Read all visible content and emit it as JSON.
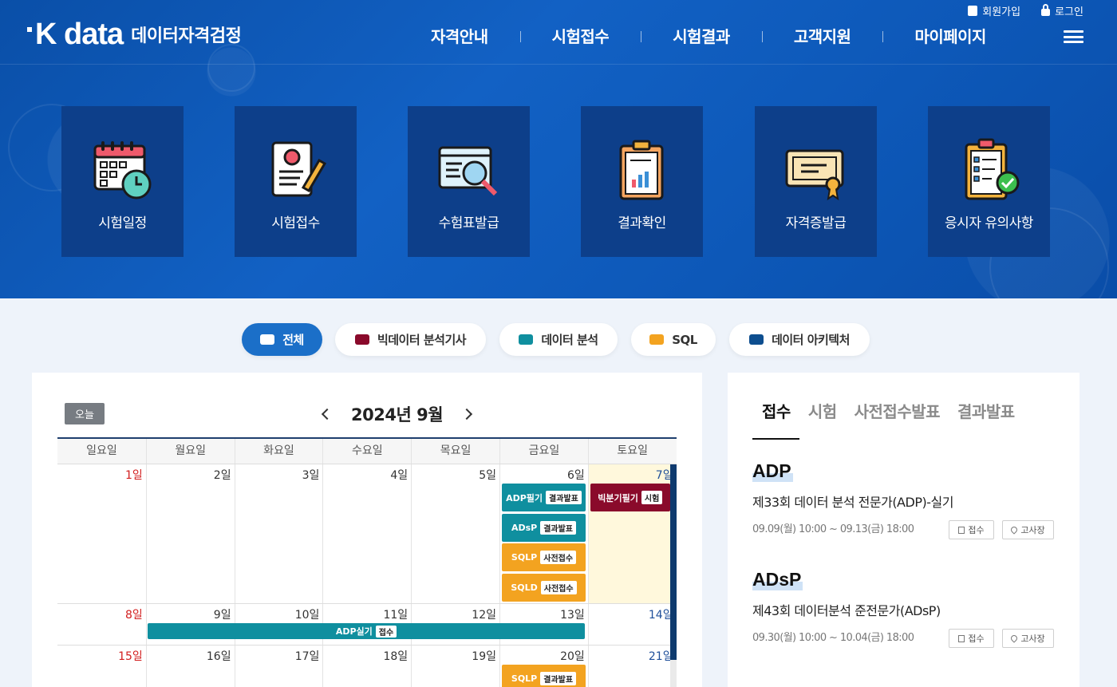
{
  "header": {
    "logo_mark": "K data",
    "logo_text": "데이터자격검정",
    "util": {
      "signup": "회원가입",
      "login": "로그인"
    },
    "nav": [
      "자격안내",
      "시험접수",
      "시험결과",
      "고객지원",
      "마이페이지"
    ]
  },
  "quick_menu": [
    {
      "label": "시험일정",
      "icon": "calendar-clock-icon"
    },
    {
      "label": "시험접수",
      "icon": "application-form-icon"
    },
    {
      "label": "수험표발급",
      "icon": "search-window-icon"
    },
    {
      "label": "결과확인",
      "icon": "clipboard-chart-icon"
    },
    {
      "label": "자격증발급",
      "icon": "certificate-icon"
    },
    {
      "label": "응시자 유의사항",
      "icon": "checklist-icon"
    }
  ],
  "filters": [
    {
      "label": "전체",
      "color": "#ffffff",
      "active": true
    },
    {
      "label": "빅데이터 분석기사",
      "color": "#8a0a2b"
    },
    {
      "label": "데이터 분석",
      "color": "#0f8f9f"
    },
    {
      "label": "SQL",
      "color": "#f3a320"
    },
    {
      "label": "데이터 아키텍처",
      "color": "#0d4e8f"
    }
  ],
  "calendar": {
    "today_label": "오늘",
    "month_title": "2024년 9월",
    "weekdays": [
      "일요일",
      "월요일",
      "화요일",
      "수요일",
      "목요일",
      "금요일",
      "토요일"
    ],
    "weeks": [
      [
        "1일",
        "2일",
        "3일",
        "4일",
        "5일",
        "6일",
        "7일"
      ],
      [
        "8일",
        "9일",
        "10일",
        "11일",
        "12일",
        "13일",
        "14일"
      ],
      [
        "15일",
        "16일",
        "17일",
        "18일",
        "19일",
        "20일",
        "21일"
      ]
    ],
    "events": {
      "adp_written": {
        "name": "ADP필기",
        "tag": "결과발표"
      },
      "adsp": {
        "name": "ADsP",
        "tag": "결과발표"
      },
      "sqlp": {
        "name": "SQLP",
        "tag": "사전접수"
      },
      "sqld": {
        "name": "SQLD",
        "tag": "사전접수"
      },
      "bigdata": {
        "name": "빅분기필기",
        "tag": "시험"
      },
      "adp_practical": {
        "name": "ADP실기",
        "tag": "접수"
      },
      "sqlp_result": {
        "name": "SQLP",
        "tag": "결과발표"
      }
    }
  },
  "info": {
    "tabs": [
      "접수",
      "시험",
      "사전접수발표",
      "결과발표"
    ],
    "sections": [
      {
        "title": "ADP",
        "item": "제33회 데이터 분석 전문가(ADP)-실기",
        "date": "09.09(월) 10:00 ~ 09.13(금) 18:00",
        "btn_apply": "접수",
        "btn_venue": "고사장"
      },
      {
        "title": "ADsP",
        "item": "제43회 데이터분석 준전문가(ADsP)",
        "date": "09.30(월) 10:00 ~ 10.04(금) 18:00",
        "btn_apply": "접수",
        "btn_venue": "고사장"
      }
    ]
  }
}
